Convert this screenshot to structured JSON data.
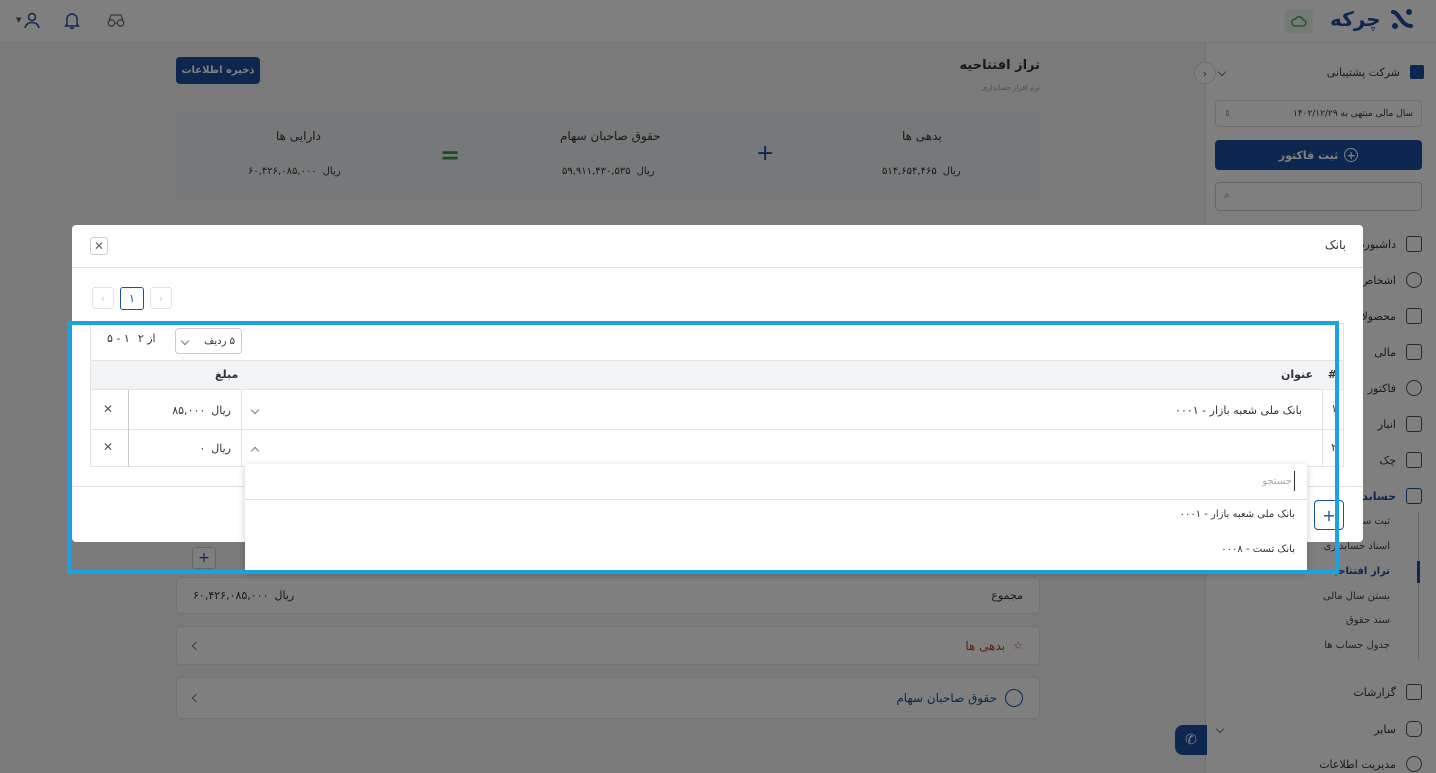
{
  "brand": {
    "name": "چرکه"
  },
  "company": {
    "name": "شرکت پشتیبانی"
  },
  "fiscal_year": {
    "label": "سال مالی منتهی به ۱۴۰۲/۱۲/۲۹"
  },
  "sidebar": {
    "new_invoice": "ثبت فاکتور",
    "search_placeholder": "",
    "items": [
      {
        "label": "داشبورد"
      },
      {
        "label": "اشخاص"
      },
      {
        "label": "محصولات"
      },
      {
        "label": "مالی"
      },
      {
        "label": "فاکتور"
      },
      {
        "label": "انبار"
      },
      {
        "label": "چک"
      },
      {
        "label": "حسابداری"
      }
    ],
    "sub_items": [
      {
        "label": "ثبت سند"
      },
      {
        "label": "اسناد حسابداری"
      },
      {
        "label": "تراز افتتاحیه"
      },
      {
        "label": "بستن سال مالی"
      },
      {
        "label": "سند حقوق"
      },
      {
        "label": "جدول حساب ها"
      }
    ],
    "reports": "گزارشات",
    "other": "سایر",
    "data_management": "مدیریت اطلاعات"
  },
  "page": {
    "title": "تراز افتتاحیه",
    "subtitle": "نرم افزار حسابداری",
    "save_button": "ذخیره اطلاعات",
    "summary": {
      "liabilities": {
        "label": "بدهی ها",
        "value": "۵۱۴,۶۵۴,۴۶۵",
        "unit": "ریال"
      },
      "equity": {
        "label": "حقوق صاحبان سهام",
        "value": "۵۹,۹۱۱,۴۳۰,۵۳۵",
        "unit": "ریال"
      },
      "assets": {
        "label": "دارایی ها",
        "value": "۶۰,۴۲۶,۰۸۵,۰۰۰",
        "unit": "ریال"
      },
      "plus": "+",
      "equals": "="
    },
    "total": {
      "label": "مجموع",
      "value": "۶۰,۴۲۶,۰۸۵,۰۰۰",
      "unit": "ریال"
    },
    "sections": [
      {
        "label": "بدهی ها"
      },
      {
        "label": "حقوق صاحبان سهام"
      }
    ]
  },
  "modal": {
    "title": "بانک",
    "pagination": {
      "current": "۱"
    },
    "rows_per_page": "۵ ردیف",
    "range": "۱ - ۵",
    "of_total": "از ۲",
    "columns": {
      "index": "#",
      "title": "عنوان",
      "amount": "مبلغ"
    },
    "rows": [
      {
        "index": "۱",
        "title": "بانک ملی شعبه بازار - ۰۰۰۱",
        "amount": "۸۵,۰۰۰",
        "unit": "ریال"
      },
      {
        "index": "۲",
        "title": "",
        "amount": "۰",
        "unit": "ریال"
      }
    ]
  },
  "dropdown": {
    "search_placeholder": "جستجو",
    "options": [
      {
        "label": "بانک ملی شعبه بازار - ۰۰۰۱"
      },
      {
        "label": "بانک تست - ۰۰۰۸"
      }
    ]
  },
  "colors": {
    "primary": "#1a4fa3",
    "highlight": "#1ba3e0",
    "equals": "#2e9e3e",
    "danger": "#c0392b"
  }
}
